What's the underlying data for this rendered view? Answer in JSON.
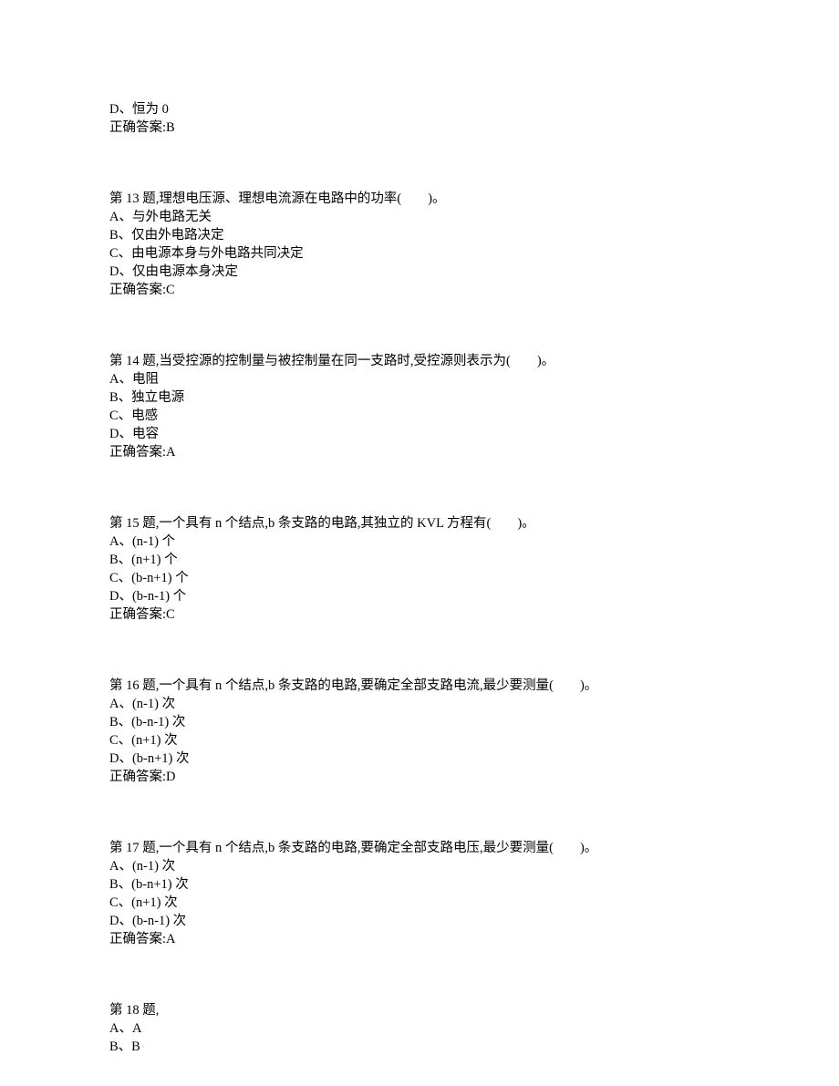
{
  "prev": {
    "optionD": "D、恒为 0",
    "answer": "正确答案:B"
  },
  "q13": {
    "stem": "第 13 题,理想电压源、理想电流源在电路中的功率(　　)。",
    "A": "A、与外电路无关",
    "B": "B、仅由外电路决定",
    "C": "C、由电源本身与外电路共同决定",
    "D": "D、仅由电源本身决定",
    "answer": "正确答案:C"
  },
  "q14": {
    "stem": "第 14 题,当受控源的控制量与被控制量在同一支路时,受控源则表示为(　　)。",
    "A": "A、电阻",
    "B": "B、独立电源",
    "C": "C、电感",
    "D": "D、电容",
    "answer": "正确答案:A"
  },
  "q15": {
    "stem": "第 15 题,一个具有 n 个结点,b 条支路的电路,其独立的 KVL 方程有(　　)。",
    "A": "A、(n-1) 个",
    "B": "B、(n+1) 个",
    "C": "C、(b-n+1) 个",
    "D": "D、(b-n-1) 个",
    "answer": "正确答案:C"
  },
  "q16": {
    "stem": "第 16 题,一个具有 n 个结点,b 条支路的电路,要确定全部支路电流,最少要测量(　　)。",
    "A": "A、(n-1) 次",
    "B": "B、(b-n-1) 次",
    "C": "C、(n+1) 次",
    "D": "D、(b-n+1) 次",
    "answer": "正确答案:D"
  },
  "q17": {
    "stem": "第 17 题,一个具有 n 个结点,b 条支路的电路,要确定全部支路电压,最少要测量(　　)。",
    "A": "A、(n-1) 次",
    "B": "B、(b-n+1) 次",
    "C": "C、(n+1) 次",
    "D": "D、(b-n-1) 次",
    "answer": "正确答案:A"
  },
  "q18": {
    "stem": "第 18 题,",
    "A": "A、A",
    "B": "B、B"
  }
}
